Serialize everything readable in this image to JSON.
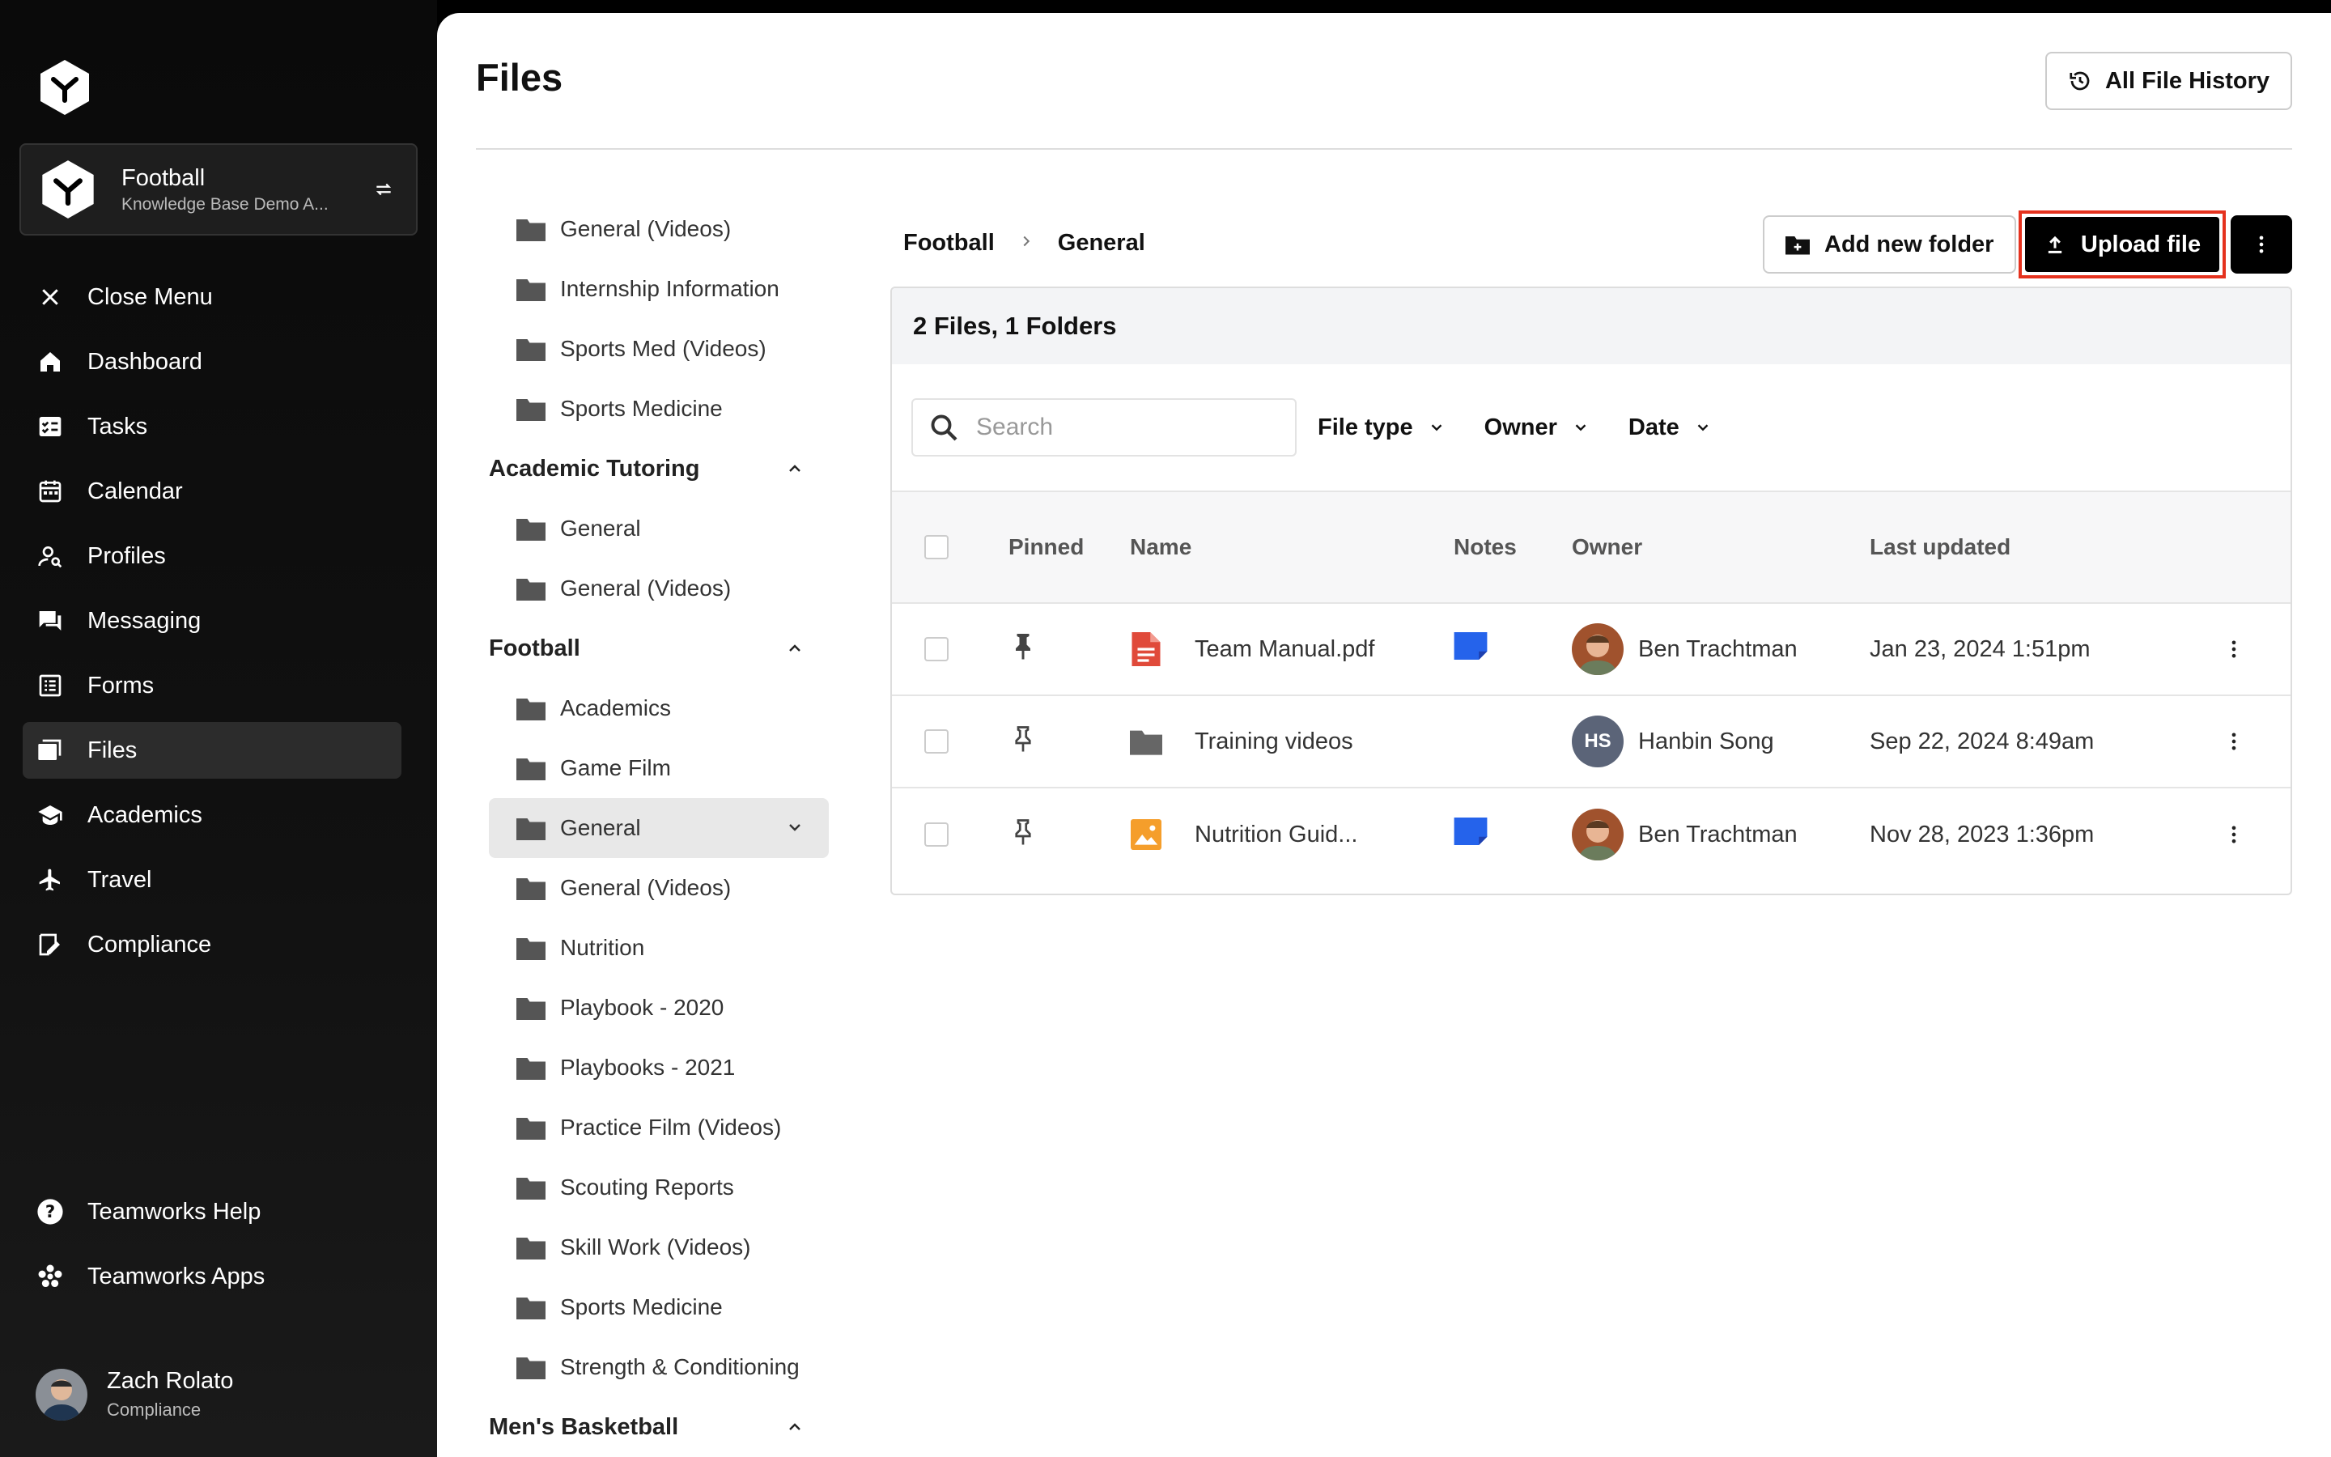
{
  "sidebar": {
    "team_name": "Football",
    "team_sub": "Knowledge Base Demo A...",
    "nav": [
      {
        "label": "Close Menu",
        "icon": "close-icon"
      },
      {
        "label": "Dashboard",
        "icon": "home-icon"
      },
      {
        "label": "Tasks",
        "icon": "tasks-icon"
      },
      {
        "label": "Calendar",
        "icon": "calendar-icon"
      },
      {
        "label": "Profiles",
        "icon": "profile-search-icon"
      },
      {
        "label": "Messaging",
        "icon": "chat-icon"
      },
      {
        "label": "Forms",
        "icon": "forms-icon"
      },
      {
        "label": "Files",
        "icon": "files-icon",
        "active": true
      },
      {
        "label": "Academics",
        "icon": "graduation-cap-icon"
      },
      {
        "label": "Travel",
        "icon": "airplane-icon"
      },
      {
        "label": "Compliance",
        "icon": "compliance-icon"
      }
    ],
    "bottom": [
      {
        "label": "Teamworks Help",
        "icon": "help-icon"
      },
      {
        "label": "Teamworks Apps",
        "icon": "apps-icon"
      }
    ],
    "user": {
      "name": "Zach Rolato",
      "role": "Compliance"
    }
  },
  "header": {
    "title": "Files",
    "history_label": "All File History"
  },
  "tree": {
    "top_folders": [
      "General (Videos)",
      "Internship Information",
      "Sports Med (Videos)",
      "Sports Medicine"
    ],
    "groups": [
      {
        "label": "Academic Tutoring",
        "folders": [
          "General",
          "General (Videos)"
        ]
      },
      {
        "label": "Football",
        "folders": [
          "Academics",
          "Game Film",
          "General",
          "General (Videos)",
          "Nutrition",
          "Playbook - 2020",
          "Playbooks - 2021",
          "Practice Film (Videos)",
          "Scouting Reports",
          "Skill Work (Videos)",
          "Sports Medicine",
          "Strength & Conditioning"
        ]
      },
      {
        "label": "Men's Basketball",
        "folders": []
      }
    ]
  },
  "content": {
    "breadcrumb": [
      "Football",
      "General"
    ],
    "add_folder_label": "Add new folder",
    "upload_label": "Upload file",
    "summary": "2 Files, 1 Folders",
    "search_placeholder": "Search",
    "filters": [
      "File type",
      "Owner",
      "Date"
    ],
    "columns": [
      "Pinned",
      "Name",
      "Notes",
      "Owner",
      "Last updated"
    ],
    "rows": [
      {
        "name": "Team Manual.pdf",
        "type": "pdf",
        "pinned": true,
        "notes": true,
        "owner": "Ben Trachtman",
        "owner_initials": "",
        "updated": "Jan 23, 2024 1:51pm"
      },
      {
        "name": "Training videos",
        "type": "folder",
        "pinned": false,
        "notes": false,
        "owner": "Hanbin Song",
        "owner_initials": "HS",
        "updated": "Sep 22, 2024 8:49am"
      },
      {
        "name": "Nutrition Guid...",
        "type": "image",
        "pinned": false,
        "notes": true,
        "owner": "Ben Trachtman",
        "owner_initials": "",
        "updated": "Nov 28, 2023 1:36pm"
      }
    ]
  },
  "colors": {
    "accent": "#e5321e",
    "notes": "#2563eb",
    "pdf": "#e04a3a",
    "image": "#f59e2b"
  }
}
